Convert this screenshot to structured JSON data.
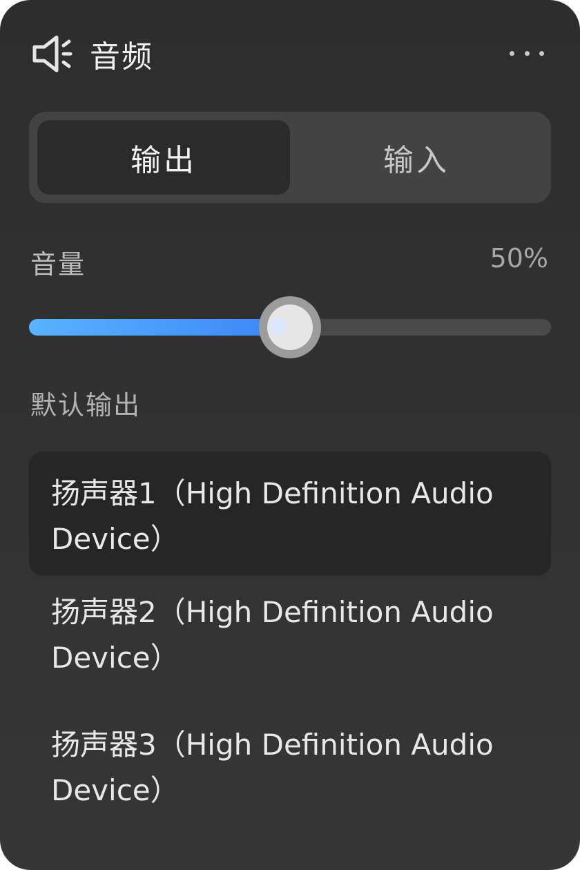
{
  "header": {
    "icon": "speaker-icon",
    "title": "音频",
    "more_icon": "more-icon"
  },
  "tabs": [
    {
      "label": "输出",
      "active": true
    },
    {
      "label": "输入",
      "active": false
    }
  ],
  "volume": {
    "label": "音量",
    "value_text": "50%",
    "level": 0.5,
    "fill_color": "#3a86f7"
  },
  "output": {
    "section_label": "默认输出",
    "devices": [
      {
        "label": "扬声器1（High Definition Audio Device）",
        "selected": true
      },
      {
        "label": "扬声器2（High Definition Audio Device）",
        "selected": false
      },
      {
        "label": "扬声器3（High Definition Audio Device）",
        "selected": false
      }
    ]
  }
}
